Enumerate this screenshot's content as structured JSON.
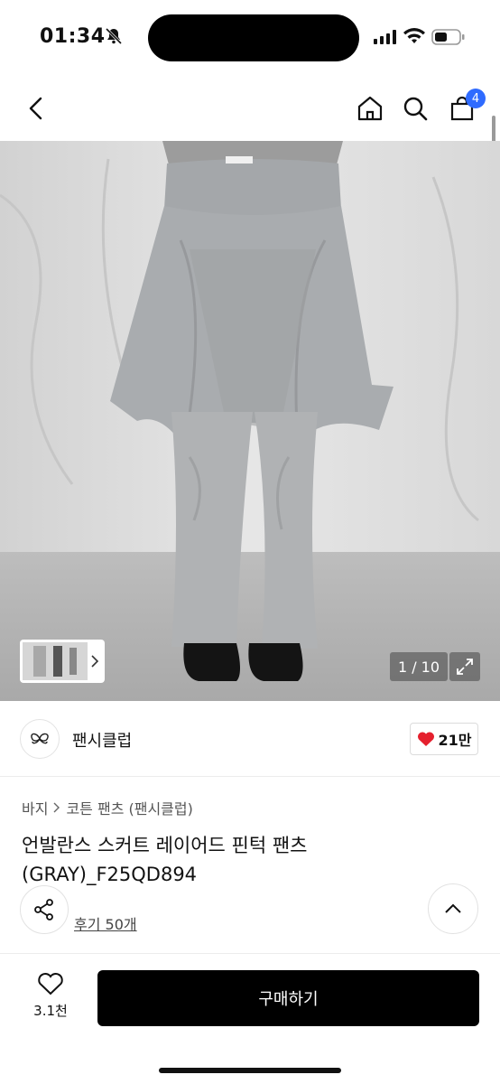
{
  "status_bar": {
    "time": "01:34"
  },
  "header": {
    "cart_count": "4"
  },
  "gallery": {
    "counter": "1 / 10"
  },
  "brand": {
    "name": "팬시클럽",
    "likes": "21만"
  },
  "product": {
    "breadcrumb": [
      "바지",
      "코튼 팬츠 (팬시클럽)"
    ],
    "title": "언발란스 스커트 레이어드 핀턱 팬츠 (GRAY)_F25QD894",
    "reviews": "후기 50개"
  },
  "bottom_bar": {
    "wish_count": "3.1천",
    "buy_label": "구매하기"
  },
  "colors": {
    "accent": "#2f6bff",
    "like": "#e5202e",
    "primary_button": "#000000"
  }
}
